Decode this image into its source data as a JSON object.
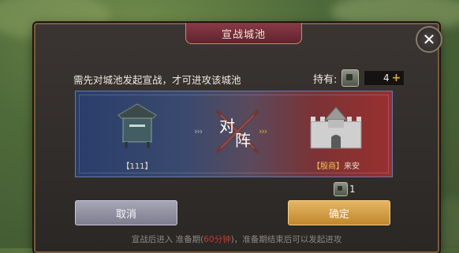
{
  "dialog": {
    "title": "宣战城池",
    "close_label": "✕",
    "instruction": "需先对城池发起宣战，才可进攻该城池",
    "holding_label": "持有:",
    "holding_count": "4",
    "holding_add": "+"
  },
  "battle": {
    "left_city_label": "【111】",
    "vs_char_1": "对",
    "vs_char_2": "阵",
    "arrows": "›››",
    "right_city_tag": "【殷商】",
    "right_city_name": "来安",
    "cost_count": "1"
  },
  "buttons": {
    "cancel": "取消",
    "confirm": "确定"
  },
  "footer": {
    "part1": "宣战后进入 准备期(",
    "highlight": "60分钟",
    "part2": ")，准备期结束后可以发起进攻"
  },
  "colors": {
    "accent_gold": "#e0a93a",
    "title_plate": "#6e2d38",
    "panel_blue": "#2a3e6a",
    "panel_red": "#9a2f2f",
    "highlight_red": "#c43a32"
  },
  "icons": {
    "close": "close-icon",
    "token": "token-icon",
    "left_city": "city-gate-icon",
    "right_city": "fortress-icon",
    "crossed_swords": "crossed-swords-icon"
  }
}
